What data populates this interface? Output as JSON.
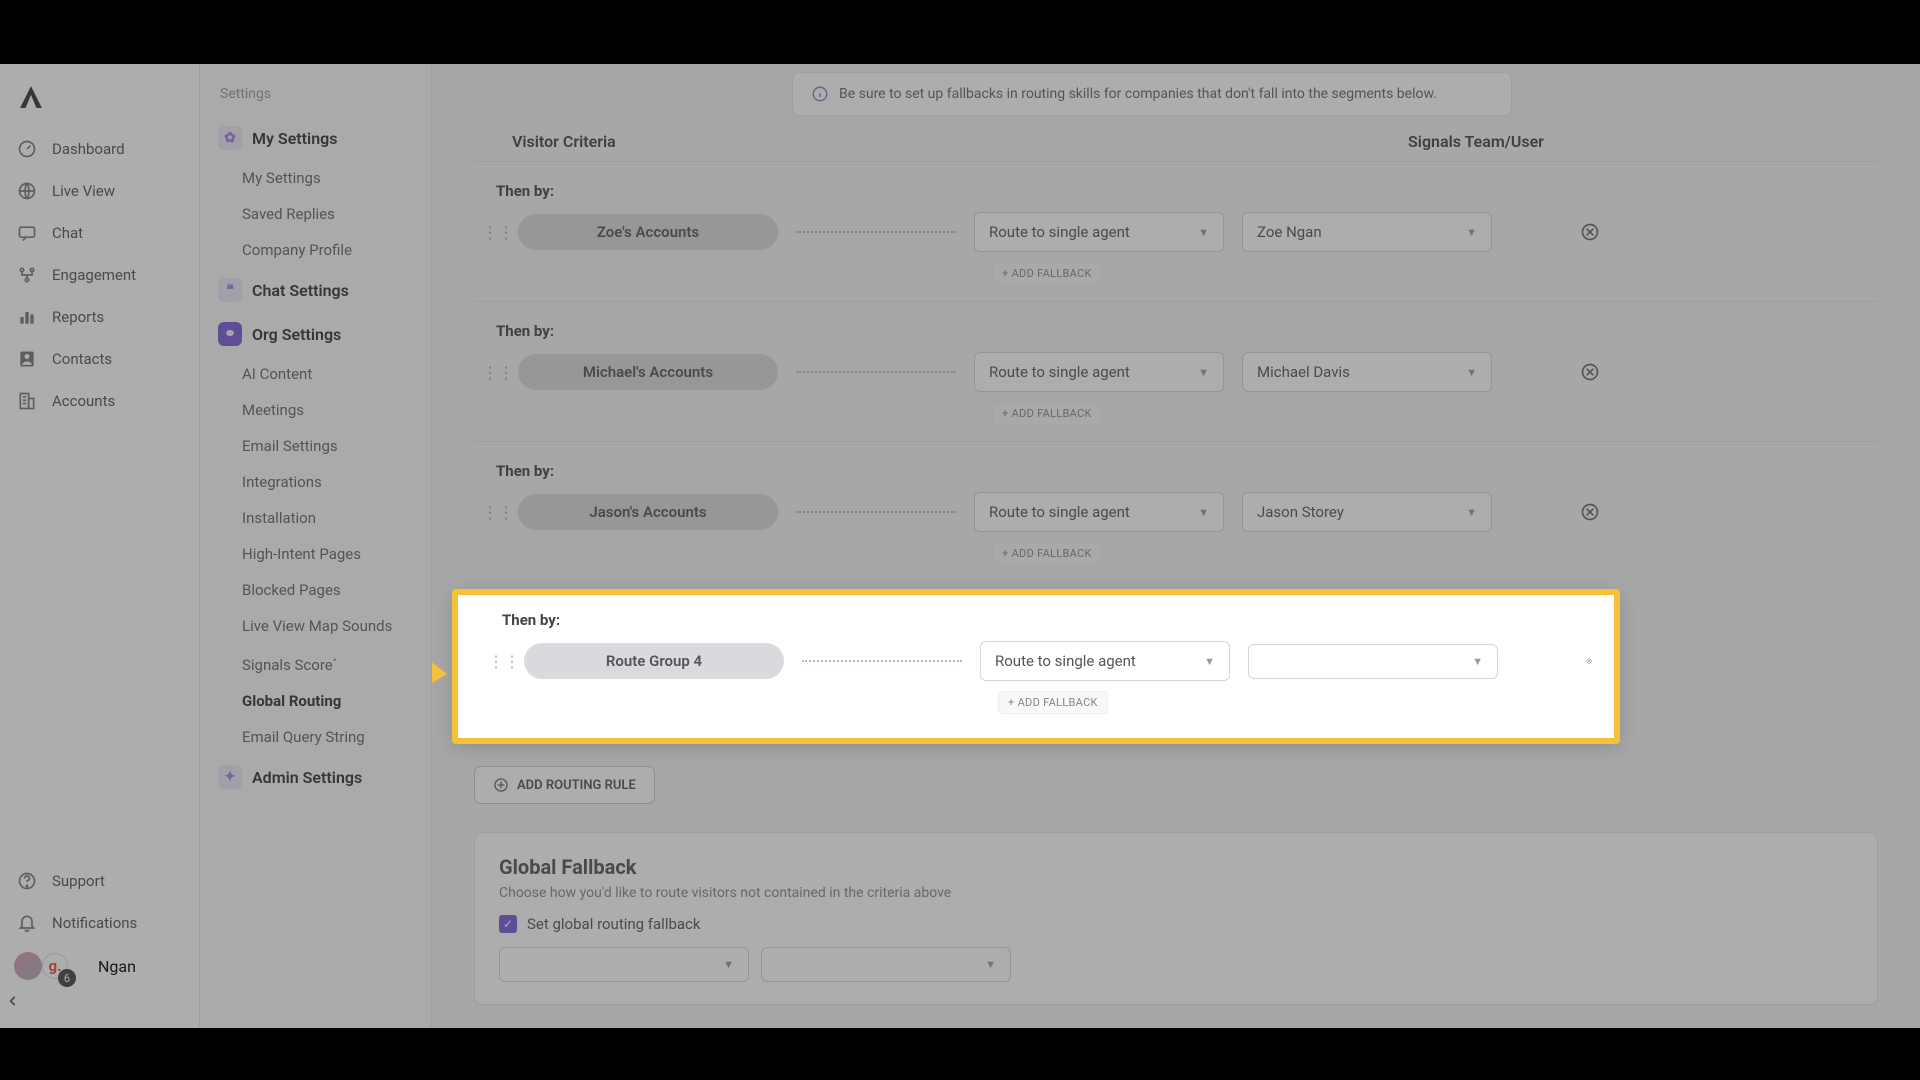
{
  "nav": {
    "items": [
      {
        "label": "Dashboard"
      },
      {
        "label": "Live View"
      },
      {
        "label": "Chat"
      },
      {
        "label": "Engagement"
      },
      {
        "label": "Reports"
      },
      {
        "label": "Contacts"
      },
      {
        "label": "Accounts"
      }
    ],
    "support": "Support",
    "notifications": "Notifications",
    "user": "Ngan",
    "badge": "6",
    "g": "g."
  },
  "sidebar": {
    "title": "Settings",
    "sections": {
      "my": "My Settings",
      "chat": "Chat Settings",
      "org": "Org Settings",
      "admin": "Admin Settings"
    },
    "my_links": [
      "My Settings",
      "Saved Replies",
      "Company Profile"
    ],
    "org_links": [
      "AI Content",
      "Meetings",
      "Email Settings",
      "Integrations",
      "Installation",
      "High-Intent Pages",
      "Blocked Pages",
      "Live View Map Sounds",
      "Signals Score",
      "Global Routing",
      "Email Query String"
    ]
  },
  "info": "Be sure to set up fallbacks in routing skills for companies that don't fall into the segments below.",
  "headers": {
    "a": "Visitor Criteria",
    "b": "Signals Team/User"
  },
  "then_by": "Then by:",
  "rules": [
    {
      "chip": "Zoe's Accounts",
      "route": "Route to single agent",
      "user": "Zoe Ngan"
    },
    {
      "chip": "Michael's Accounts",
      "route": "Route to single agent",
      "user": "Michael Davis"
    },
    {
      "chip": "Jason's Accounts",
      "route": "Route to single agent",
      "user": "Jason Storey"
    },
    {
      "chip": "Route Group 4",
      "route": "Route to single agent",
      "user": ""
    }
  ],
  "add_fallback": "+ ADD FALLBACK",
  "add_rule": "ADD ROUTING RULE",
  "fallback": {
    "title": "Global Fallback",
    "desc": "Choose how you'd like to route visitors not contained in the criteria above",
    "cb": "Set global routing fallback"
  }
}
